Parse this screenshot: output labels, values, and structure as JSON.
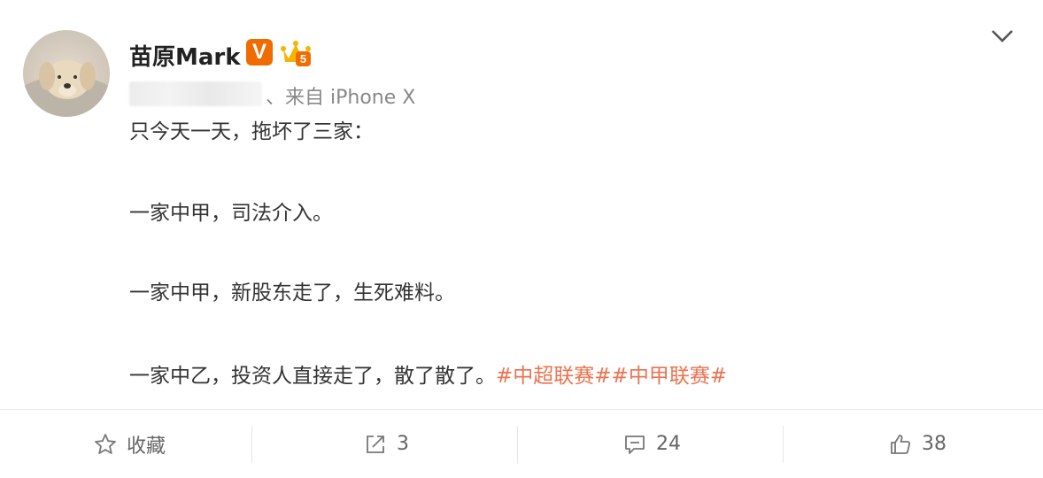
{
  "post": {
    "author": "苗原Mark",
    "verified_badge": "V",
    "level_badge": "5",
    "source": "、来自 iPhone X",
    "text_line1": "只今天一天，拖坏了三家：",
    "text_line2": "一家中甲，司法介入。",
    "text_line3": "一家中甲，新股东走了，生死难料。",
    "text_line4": "一家中乙，投资人直接走了，散了散了。",
    "hashtags": [
      "#中超联赛#",
      "#中甲联赛#"
    ]
  },
  "actions": {
    "favorite_label": "收藏",
    "repost_count": "3",
    "comment_count": "24",
    "like_count": "38"
  },
  "colors": {
    "verified": "#f06c00",
    "hashtag": "#eb7350"
  }
}
